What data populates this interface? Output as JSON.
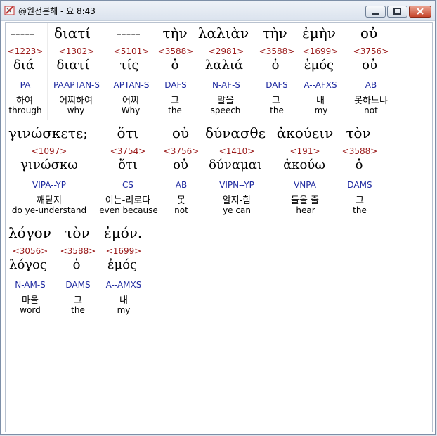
{
  "window": {
    "title": "@원전본해 - 요 8:43"
  },
  "rows": [
    {
      "words": [
        {
          "surface": "-----",
          "strong": "<1223>",
          "lemma": "διά",
          "parse": "PA",
          "kor": "하여",
          "eng": "through"
        },
        {
          "surface": "διατί",
          "strong": "<1302>",
          "lemma": "διατί",
          "parse": "PAAPTAN-S",
          "kor": "어찌하여",
          "eng": "why"
        },
        {
          "surface": "-----",
          "strong": "<5101>",
          "lemma": "τίς",
          "parse": "APTAN-S",
          "kor": "어찌",
          "eng": "Why"
        },
        {
          "surface": "τὴν",
          "strong": "<3588>",
          "lemma": "ὁ",
          "parse": "DAFS",
          "kor": "그",
          "eng": "the"
        },
        {
          "surface": "λαλιὰν",
          "strong": "<2981>",
          "lemma": "λαλιά",
          "parse": "N-AF-S",
          "kor": "말을",
          "eng": "speech"
        },
        {
          "surface": "τὴν",
          "strong": "<3588>",
          "lemma": "ὁ",
          "parse": "DAFS",
          "kor": "그",
          "eng": "the"
        },
        {
          "surface": "ἐμὴν",
          "strong": "<1699>",
          "lemma": "ἐμός",
          "parse": "A--AFXS",
          "kor": "내",
          "eng": "my"
        },
        {
          "surface": "οὐ",
          "strong": "<3756>",
          "lemma": "οὐ",
          "parse": "AB",
          "kor": "못하느냐",
          "eng": "not"
        }
      ]
    },
    {
      "words": [
        {
          "surface": "γινώσκετε;",
          "strong": "<1097>",
          "lemma": "γινώσκω",
          "parse": "VIPA--YP",
          "kor": "깨닫지",
          "eng": "do ye-understand"
        },
        {
          "surface": "ὅτι",
          "strong": "<3754>",
          "lemma": "ὅτι",
          "parse": "CS",
          "kor": "이는-리로다",
          "eng": "even because"
        },
        {
          "surface": "οὐ",
          "strong": "<3756>",
          "lemma": "οὐ",
          "parse": "AB",
          "kor": "못",
          "eng": "not"
        },
        {
          "surface": "δύνασθε",
          "strong": "<1410>",
          "lemma": "δύναμαι",
          "parse": "VIPN--YP",
          "kor": "알지-함",
          "eng": "ye can"
        },
        {
          "surface": "ἀκούειν",
          "strong": "<191>",
          "lemma": "ἀκούω",
          "parse": "VNPA",
          "kor": "들을 줄",
          "eng": "hear"
        },
        {
          "surface": "τὸν",
          "strong": "<3588>",
          "lemma": "ὁ",
          "parse": "DAMS",
          "kor": "그",
          "eng": "the"
        }
      ]
    },
    {
      "words": [
        {
          "surface": "λόγον",
          "strong": "<3056>",
          "lemma": "λόγος",
          "parse": "N-AM-S",
          "kor": "마을",
          "eng": "word"
        },
        {
          "surface": "τὸν",
          "strong": "<3588>",
          "lemma": "ὁ",
          "parse": "DAMS",
          "kor": "그",
          "eng": "the"
        },
        {
          "surface": "ἐμόν.",
          "strong": "<1699>",
          "lemma": "ἐμός",
          "parse": "A--AMXS",
          "kor": "내",
          "eng": "my"
        }
      ]
    }
  ]
}
